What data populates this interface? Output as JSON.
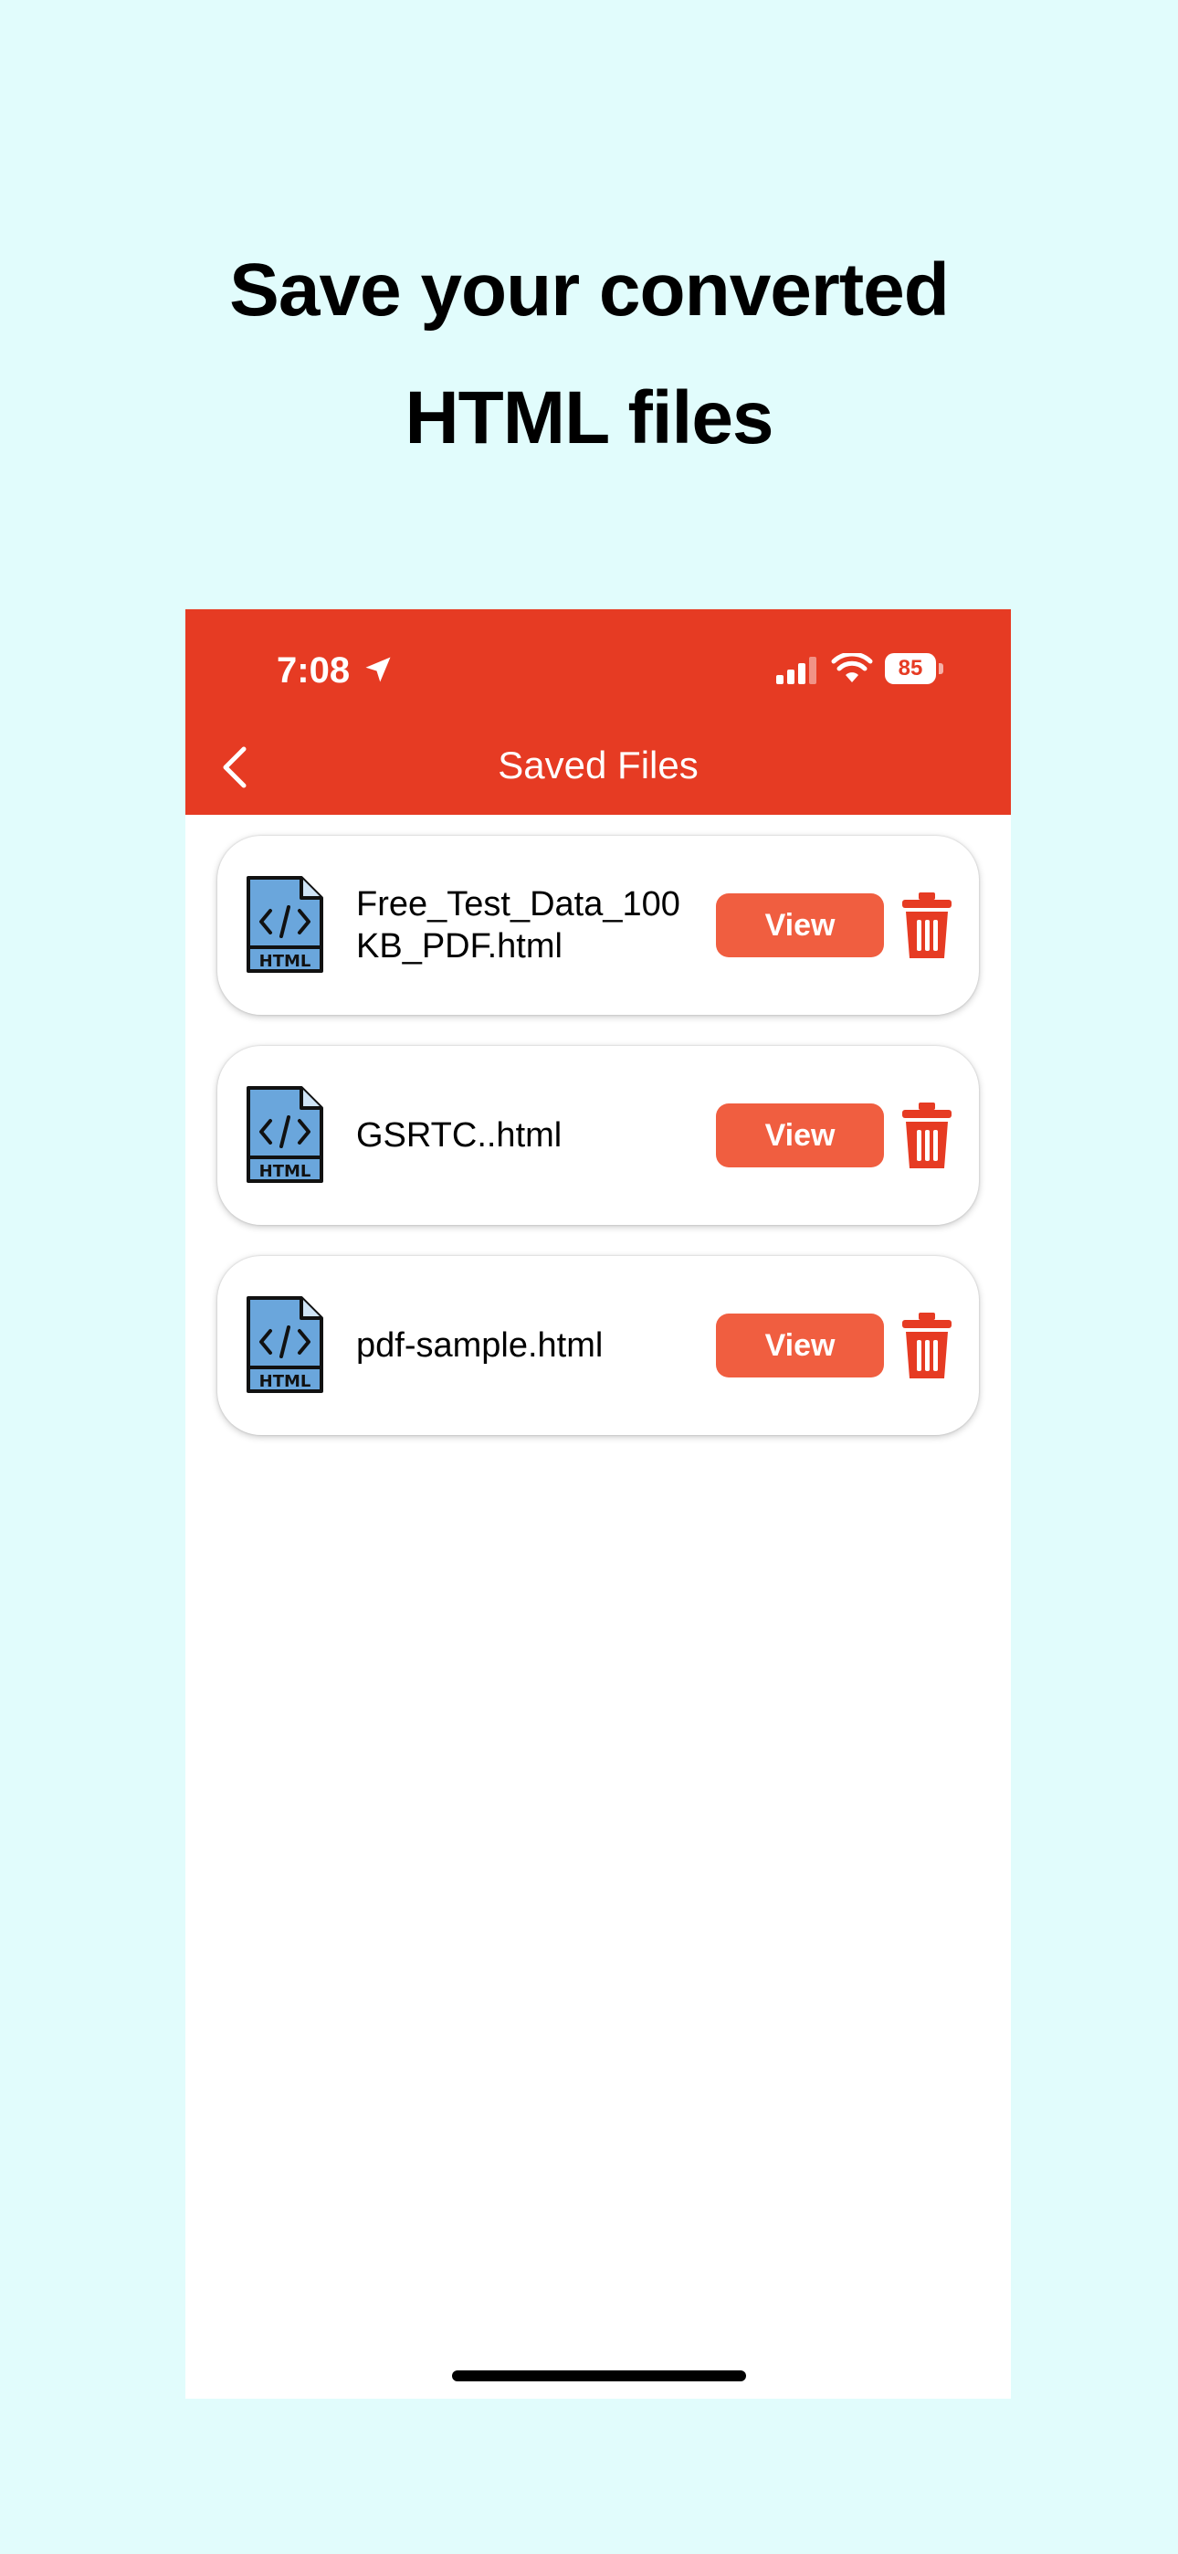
{
  "headline": {
    "line1": "Save your converted",
    "line2": "HTML files"
  },
  "status_bar": {
    "time": "7:08",
    "battery": "85",
    "icons": [
      "location-arrow-icon",
      "signal-icon",
      "wifi-icon",
      "battery-icon"
    ]
  },
  "nav": {
    "title": "Saved Files",
    "back_icon": "chevron-left-icon"
  },
  "files": [
    {
      "name": "Free_Test_Data_100KB_PDF.html",
      "view_label": "View",
      "icon": "html-file-icon",
      "delete_icon": "trash-icon"
    },
    {
      "name": "GSRTC..html",
      "view_label": "View",
      "icon": "html-file-icon",
      "delete_icon": "trash-icon"
    },
    {
      "name": "pdf-sample.html",
      "view_label": "View",
      "icon": "html-file-icon",
      "delete_icon": "trash-icon"
    }
  ],
  "colors": {
    "background": "#e1fcfc",
    "header": "#e63b23",
    "view_button": "#f05e40",
    "trash": "#e63b23",
    "file_icon_fill": "#6aa6dc"
  }
}
